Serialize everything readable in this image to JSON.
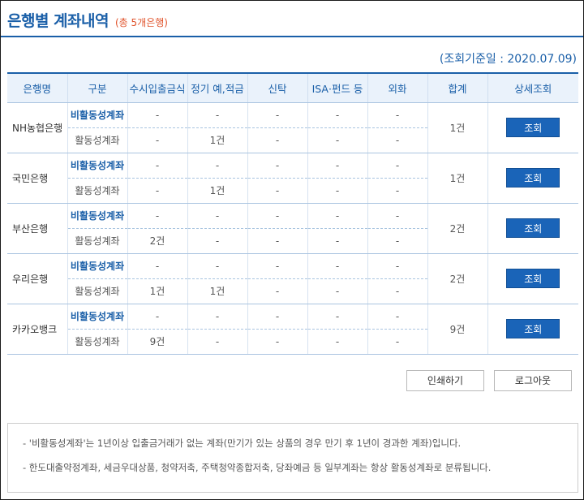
{
  "header": {
    "title": "은행별 계좌내역",
    "subtitle": "(총 5개은행)"
  },
  "date_note": "(조회기준일 : 2020.07.09)",
  "table": {
    "headers": [
      "은행명",
      "구분",
      "수시입출금식",
      "정기 예,적금",
      "신탁",
      "ISA·펀드 등",
      "외화",
      "합계",
      "상세조회"
    ],
    "banks": [
      {
        "name": "NH농협은행",
        "total": "1건",
        "button": "조회",
        "rows": [
          {
            "kind": "비활동성계좌",
            "cells": [
              "-",
              "-",
              "-",
              "-",
              "-"
            ]
          },
          {
            "kind": "활동성계좌",
            "cells": [
              "-",
              "1건",
              "-",
              "-",
              "-"
            ]
          }
        ]
      },
      {
        "name": "국민은행",
        "total": "1건",
        "button": "조회",
        "rows": [
          {
            "kind": "비활동성계좌",
            "cells": [
              "-",
              "-",
              "-",
              "-",
              "-"
            ]
          },
          {
            "kind": "활동성계좌",
            "cells": [
              "-",
              "1건",
              "-",
              "-",
              "-"
            ]
          }
        ]
      },
      {
        "name": "부산은행",
        "total": "2건",
        "button": "조회",
        "rows": [
          {
            "kind": "비활동성계좌",
            "cells": [
              "-",
              "-",
              "-",
              "-",
              "-"
            ]
          },
          {
            "kind": "활동성계좌",
            "cells": [
              "2건",
              "-",
              "-",
              "-",
              "-"
            ]
          }
        ]
      },
      {
        "name": "우리은행",
        "total": "2건",
        "button": "조회",
        "rows": [
          {
            "kind": "비활동성계좌",
            "cells": [
              "-",
              "-",
              "-",
              "-",
              "-"
            ]
          },
          {
            "kind": "활동성계좌",
            "cells": [
              "1건",
              "1건",
              "-",
              "-",
              "-"
            ]
          }
        ]
      },
      {
        "name": "카카오뱅크",
        "total": "9건",
        "button": "조회",
        "rows": [
          {
            "kind": "비활동성계좌",
            "cells": [
              "-",
              "-",
              "-",
              "-",
              "-"
            ]
          },
          {
            "kind": "활동성계좌",
            "cells": [
              "9건",
              "-",
              "-",
              "-",
              "-"
            ]
          }
        ]
      }
    ]
  },
  "actions": {
    "print": "인쇄하기",
    "logout": "로그아웃"
  },
  "notes": [
    "- '비활동성계좌'는 1년이상 입출금거래가 없는 계좌(만기가 있는 상품의 경우 만기 후 1년이 경과한 계좌)입니다.",
    "- 한도대출약정계좌, 세금우대상품, 청약저축, 주택청약종합저축, 당좌예금 등 일부계좌는 항상 활동성계좌로 분류됩니다."
  ],
  "colors": {
    "accent": "#1a5fa8",
    "subtitle": "#e0522a",
    "button": "#1a64b8"
  }
}
